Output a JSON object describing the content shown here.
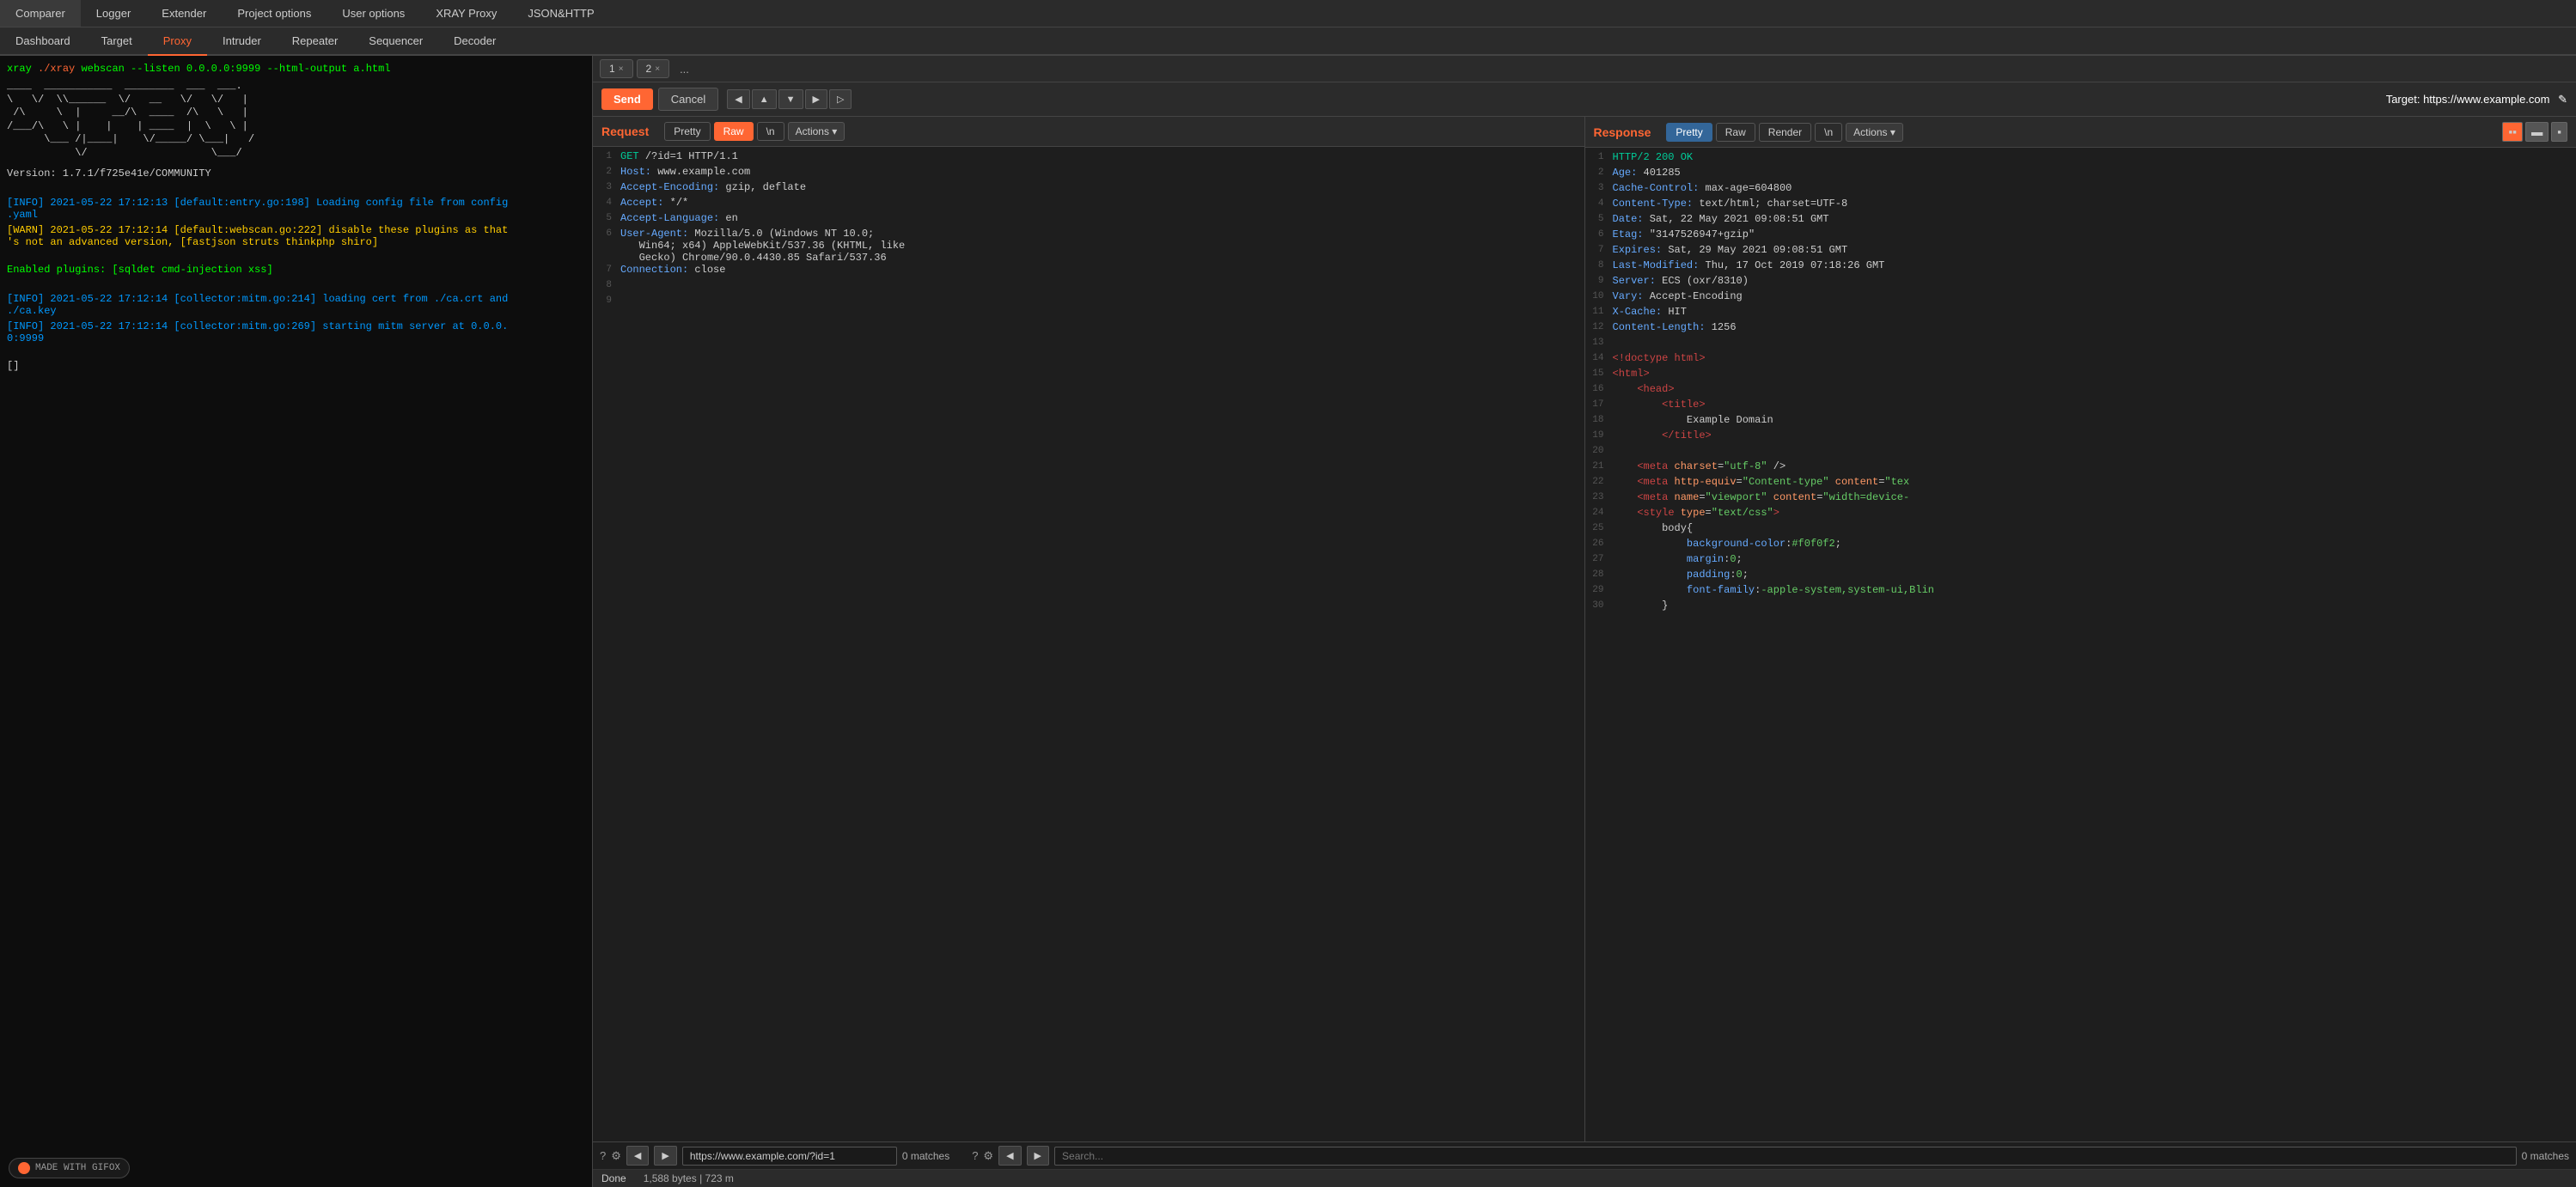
{
  "topNav": {
    "items": [
      "Comparer",
      "Logger",
      "Extender",
      "Project options",
      "User options",
      "XRAY Proxy",
      "JSON&HTTP"
    ]
  },
  "secondNav": {
    "items": [
      "Dashboard",
      "Target",
      "Proxy",
      "Intruder",
      "Repeater",
      "Sequencer",
      "Decoder"
    ],
    "active": "Proxy"
  },
  "tabs": [
    {
      "label": "1",
      "close": "×"
    },
    {
      "label": "2",
      "close": "×"
    },
    {
      "label": "..."
    }
  ],
  "toolbar": {
    "sendLabel": "Send",
    "cancelLabel": "Cancel",
    "targetLabel": "Target:",
    "targetUrl": "https://www.example.com",
    "editIcon": "✎"
  },
  "request": {
    "panelTitle": "Request",
    "formats": [
      "Pretty",
      "Raw",
      "\\ n",
      "Actions ▾"
    ],
    "activeFormat": "Raw",
    "lines": [
      {
        "num": 1,
        "content": "GET /?id=1 HTTP/1.1",
        "type": "request-line"
      },
      {
        "num": 2,
        "content": "Host: www.example.com",
        "type": "header"
      },
      {
        "num": 3,
        "content": "Accept-Encoding: gzip, deflate",
        "type": "header"
      },
      {
        "num": 4,
        "content": "Accept: */*",
        "type": "header"
      },
      {
        "num": 5,
        "content": "Accept-Language: en",
        "type": "header"
      },
      {
        "num": 6,
        "content": "User-Agent: Mozilla/5.0 (Windows NT 10.0; Win64; x64) AppleWebKit/537.36 (KHTML, like Gecko) Chrome/90.0.4430.85 Safari/537.36",
        "type": "header"
      },
      {
        "num": 7,
        "content": "Connection: close",
        "type": "header"
      },
      {
        "num": 8,
        "content": "",
        "type": "blank"
      },
      {
        "num": 9,
        "content": "",
        "type": "blank"
      }
    ]
  },
  "response": {
    "panelTitle": "Response",
    "formats": [
      "Pretty",
      "Raw",
      "Render",
      "\\ n",
      "Actions ▾"
    ],
    "activeFormat": "Pretty",
    "viewIcons": [
      "▪▪",
      "▬",
      "▪"
    ],
    "lines": [
      {
        "num": 1,
        "content": "HTTP/2 200 OK",
        "type": "status"
      },
      {
        "num": 2,
        "content": "Age: 401285",
        "type": "header"
      },
      {
        "num": 3,
        "content": "Cache-Control: max-age=604800",
        "type": "header"
      },
      {
        "num": 4,
        "content": "Content-Type: text/html; charset=UTF-8",
        "type": "header"
      },
      {
        "num": 5,
        "content": "Date: Sat, 22 May 2021 09:08:51 GMT",
        "type": "header"
      },
      {
        "num": 6,
        "content": "Etag: \"3147526947+gzip\"",
        "type": "header"
      },
      {
        "num": 7,
        "content": "Expires: Sat, 29 May 2021 09:08:51 GMT",
        "type": "header"
      },
      {
        "num": 8,
        "content": "Last-Modified: Thu, 17 Oct 2019 07:18:26 GMT",
        "type": "header"
      },
      {
        "num": 9,
        "content": "Server: ECS (oxr/8310)",
        "type": "header"
      },
      {
        "num": 10,
        "content": "Vary: Accept-Encoding",
        "type": "header"
      },
      {
        "num": 11,
        "content": "X-Cache: HIT",
        "type": "header"
      },
      {
        "num": 12,
        "content": "Content-Length: 1256",
        "type": "header"
      },
      {
        "num": 13,
        "content": "",
        "type": "blank"
      },
      {
        "num": 14,
        "content": "<!doctype html>",
        "type": "html"
      },
      {
        "num": 15,
        "content": "<html>",
        "type": "html"
      },
      {
        "num": 16,
        "content": "    <head>",
        "type": "html"
      },
      {
        "num": 17,
        "content": "        <title>",
        "type": "html"
      },
      {
        "num": 18,
        "content": "            Example Domain",
        "type": "text"
      },
      {
        "num": 19,
        "content": "        </title>",
        "type": "html"
      },
      {
        "num": 20,
        "content": "",
        "type": "blank"
      },
      {
        "num": 21,
        "content": "    <meta charset=\"utf-8\" />",
        "type": "html"
      },
      {
        "num": 22,
        "content": "    <meta http-equiv=\"Content-type\" content=\"tex",
        "type": "html"
      },
      {
        "num": 23,
        "content": "    <meta name=\"viewport\" content=\"width=device-",
        "type": "html"
      },
      {
        "num": 24,
        "content": "    <style type=\"text/css\">",
        "type": "html"
      },
      {
        "num": 25,
        "content": "        body{",
        "type": "css"
      },
      {
        "num": 26,
        "content": "            background-color:#f0f0f2;",
        "type": "css"
      },
      {
        "num": 27,
        "content": "            margin:0;",
        "type": "css"
      },
      {
        "num": 28,
        "content": "            padding:0;",
        "type": "css"
      },
      {
        "num": 29,
        "content": "            font-family:-apple-system,system-ui,Blin",
        "type": "css"
      },
      {
        "num": 30,
        "content": "        }",
        "type": "css"
      }
    ]
  },
  "terminal": {
    "cmdLine": "xray ./xray  webscan --listen 0.0.0.0:9999 --html-output a.html",
    "asciiArt": "____  ___________  ________  ___  ___.\n\\   \\/  /\\______  \\/   __   \\/   \\/   |\n /\\     \\  |     __/\\  ____  /\\   \\   |\n/___/\\   \\ |    |    | ____  |  \\   \\ |\n      \\___ /|____|    \\/_____/ \\___|   /\n           \\/                    \\___/",
    "version": "Version: 1.7.1/f725e41e/COMMUNITY",
    "logs": [
      {
        "type": "info",
        "text": "[INFO] 2021-05-22 17:12:13 [default:entry.go:198] Loading config file from config.yaml"
      },
      {
        "type": "warn",
        "text": "[WARN] 2021-05-22 17:12:14 [default:webscan.go:222] disable these plugins as that's not an advanced version, [fastjson struts thinkphp shiro]"
      },
      {
        "type": "enabled",
        "text": "Enabled plugins: [sqldet cmd-injection xss]"
      },
      {
        "type": "info",
        "text": "[INFO] 2021-05-22 17:12:14 [collector:mitm.go:214] loading cert from ./ca.crt and ./ca.key"
      },
      {
        "type": "info",
        "text": "[INFO] 2021-05-22 17:12:14 [collector:mitm.go:269] starting mitm server at 0.0.0.0:9999"
      },
      {
        "type": "cursor",
        "text": "[]"
      }
    ]
  },
  "bottomBar": {
    "reqUrl": "https://www.example.com/?id=1",
    "reqMatches": "0 matches",
    "respMatches": "0 matches",
    "searchPlaceholder": "Search...",
    "navArrows": [
      "◀",
      "▶"
    ]
  },
  "statusBar": {
    "doneText": "Done",
    "bytesText": "1,588 bytes | 723 m"
  }
}
